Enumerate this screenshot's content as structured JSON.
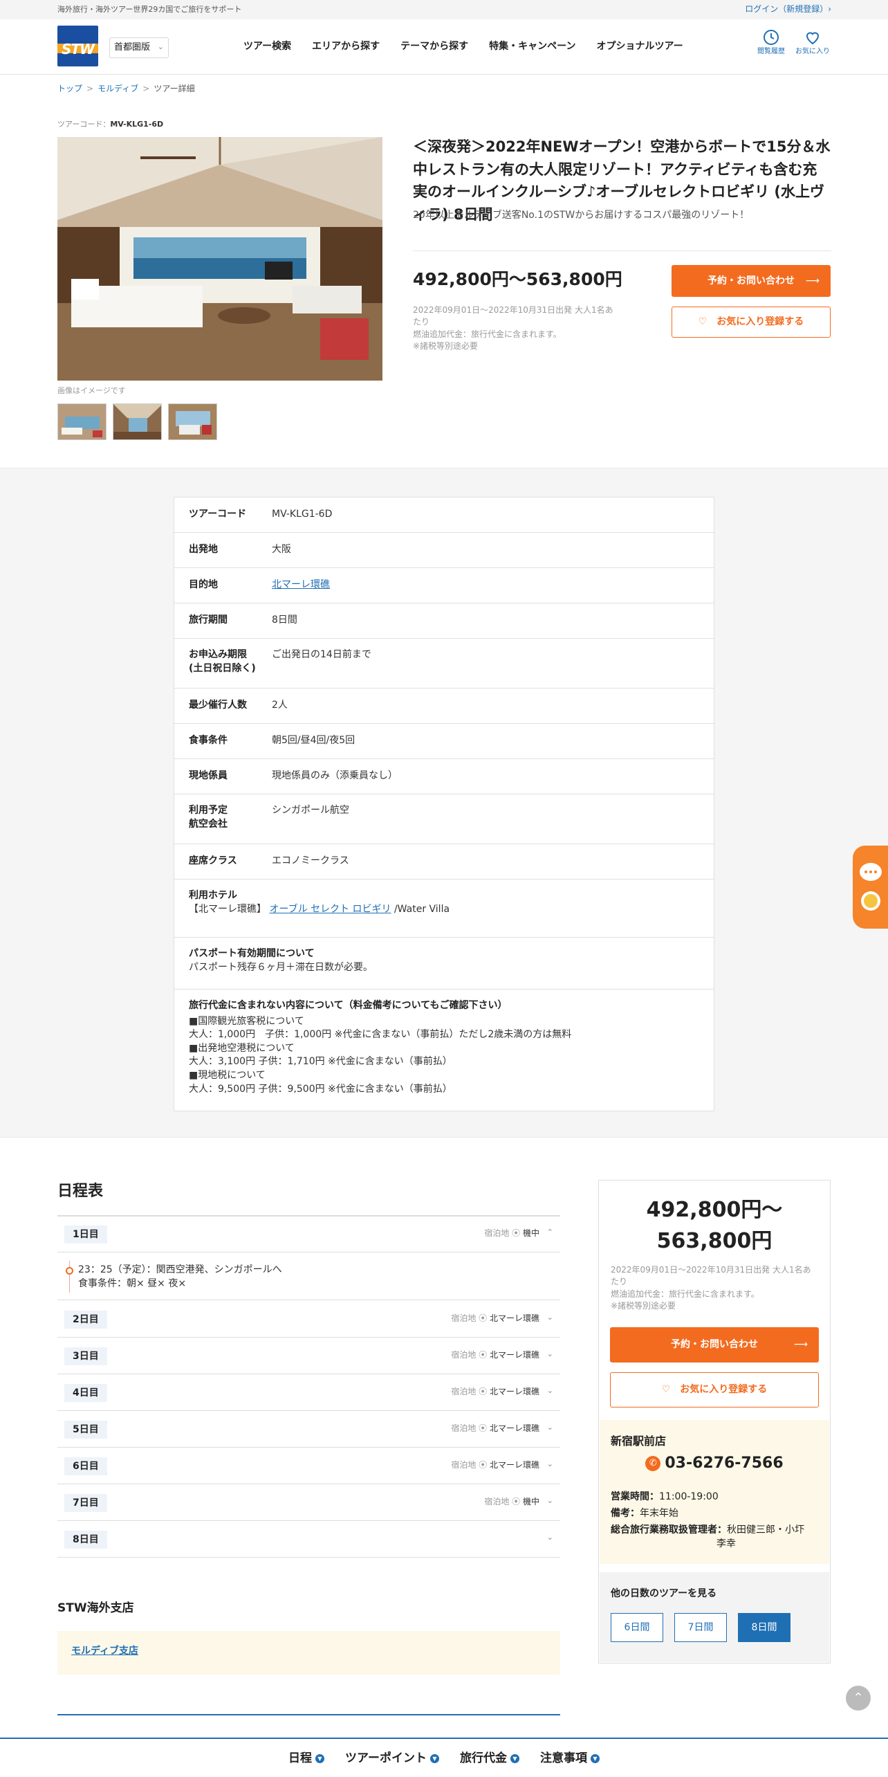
{
  "topbar": {
    "tagline": "海外旅行・海外ツアー世界29カ国でご旅行をサポート",
    "login": "ログイン（新規登録）›"
  },
  "header": {
    "logo_text": "STW",
    "region": "首都圏版",
    "nav": [
      "ツアー検索",
      "エリアから探す",
      "テーマから探す",
      "特集・キャンペーン",
      "オプショナルツアー"
    ],
    "history_label": "閲覧履歴",
    "favorites_label": "お気に入り"
  },
  "breadcrumb": {
    "home": "トップ",
    "category": "モルディブ",
    "current": "ツアー詳細",
    "sep": ">"
  },
  "tour": {
    "code_label": "ツアーコード：",
    "code": "MV-KLG1-6D",
    "image_note": "画像はイメージです",
    "title": "＜深夜発＞2022年NEWオープン！空港からボートで15分＆水中レストラン有の大人限定リゾート！アクティビティも含む充実のオールインクルーシブ♪オーブルセレクトロビギリ (水上ヴィラ) 8日間",
    "subtitle": "20年以上モルディブ送客No.1のSTWからお届けするコスパ最強のリゾート！",
    "price": "492,800円〜563,800円",
    "price_note_1": "2022年09月01日〜2022年10月31日出発 大人1名あたり",
    "price_note_2": "燃油追加代金：旅行代金に含まれます。",
    "price_note_3": "※諸税等別途必要",
    "reserve_button": "予約・お問い合わせ",
    "favorite_button": "♡　お気に入り登録する"
  },
  "details": {
    "rows": [
      {
        "key": "ツアーコード",
        "value": "MV-KLG1-6D"
      },
      {
        "key": "出発地",
        "value": "大阪"
      },
      {
        "key": "目的地",
        "value": "北マーレ環礁"
      },
      {
        "key": "旅行期間",
        "value": "8日間"
      },
      {
        "key": "お申込み期限",
        "key2": "(土日祝日除く)",
        "value": "ご出発日の14日前まで"
      },
      {
        "key": "最少催行人数",
        "value": "2人"
      },
      {
        "key": "食事条件",
        "value": "朝5回/昼4回/夜5回"
      },
      {
        "key": "現地係員",
        "value": "現地係員のみ（添乗員なし）"
      },
      {
        "key": "利用予定",
        "key2": "航空会社",
        "value": "シンガポール航空"
      },
      {
        "key": "座席クラス",
        "value": "エコノミークラス"
      }
    ],
    "hotel": {
      "key": "利用ホテル",
      "area": "【北マーレ環礁】",
      "name": "オーブル セレクト ロビギリ",
      "room": "/Water Villa"
    },
    "passport": {
      "key": "パスポート有効期間について",
      "value": "パスポート残存６ヶ月＋滞在日数が必要。"
    },
    "fees": {
      "key": "旅行代金に含まれない内容について（料金備考についてもご確認下さい）",
      "lines": [
        "■国際観光旅客税について",
        "大人：1,000円　子供：1,000円 ※代金に含まない（事前払）ただし2歳未満の方は無料",
        "■出発地空港税について",
        "大人：3,100円 子供：1,710円 ※代金に含まない（事前払）",
        "■現地税について",
        "大人：9,500円 子供：9,500円 ※代金に含まない（事前払）"
      ]
    }
  },
  "itinerary": {
    "heading": "日程表",
    "stay_label": "宿泊地",
    "days": [
      {
        "label": "1日目",
        "stay": "機中"
      },
      {
        "label": "2日目",
        "stay": "北マーレ環礁"
      },
      {
        "label": "3日目",
        "stay": "北マーレ環礁"
      },
      {
        "label": "4日目",
        "stay": "北マーレ環礁"
      },
      {
        "label": "5日目",
        "stay": "北マーレ環礁"
      },
      {
        "label": "6日目",
        "stay": "北マーレ環礁"
      },
      {
        "label": "7日目",
        "stay": "機中"
      },
      {
        "label": "8日目",
        "stay": ""
      }
    ],
    "day1_line1": "23：25（予定）：関西空港発、シンガポールへ",
    "day1_line2": "食事条件：朝× 昼× 夜×"
  },
  "branch": {
    "heading": "STW海外支店",
    "name": "モルディブ支店"
  },
  "sidebar": {
    "price_line1": "492,800円〜",
    "price_line2": "563,800円",
    "note_1": "2022年09月01日〜2022年10月31日出発 大人1名あたり",
    "note_2": "燃油追加代金：旅行代金に含まれます。",
    "note_3": "※諸税等別途必要",
    "reserve_button": "予約・お問い合わせ",
    "favorite_button": "♡　お気に入り登録する",
    "shop": {
      "name": "新宿駅前店",
      "tel": "03-6276-7566",
      "hours_label": "営業時間：",
      "hours": "11:00-19:00",
      "note_label": "備考：",
      "note": "年末年始",
      "manager_label": "総合旅行業務取扱管理者：",
      "manager_1": "秋田健三郎・小圷",
      "manager_2": "李幸"
    },
    "other": {
      "heading": "他の日数のツアーを見る",
      "options": [
        "6日間",
        "7日間",
        "8日間"
      ],
      "selected": "8日間"
    }
  },
  "bottom_nav": [
    "日程",
    "ツアーポイント",
    "旅行代金",
    "注意事項"
  ],
  "colors": {
    "accent": "#f36b1f",
    "link": "#1f6fb5",
    "brand_blue": "#1a4ea0"
  }
}
